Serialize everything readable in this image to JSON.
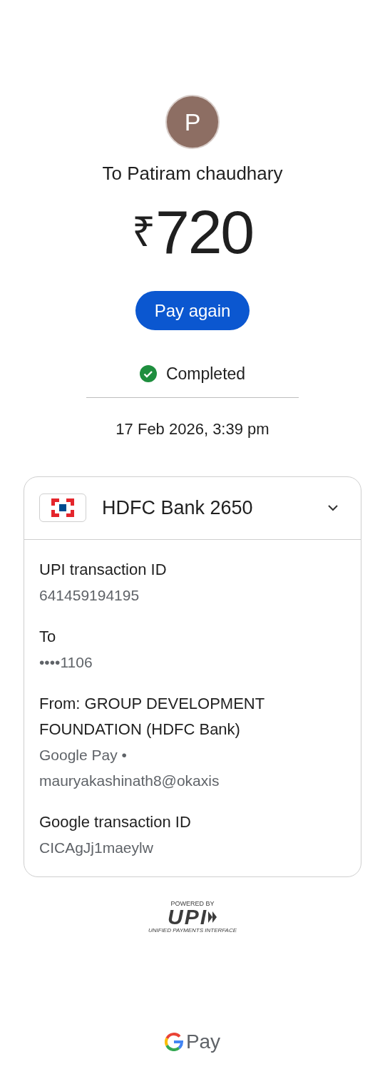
{
  "payee": {
    "initial": "P",
    "name": "To Patiram chaudhary"
  },
  "amount": {
    "currency": "₹",
    "value": "720"
  },
  "pay_again_button": "Pay again",
  "status": {
    "kind": "completed",
    "label": "Completed"
  },
  "datetime": "17 Feb 2026, 3:39 pm",
  "account": {
    "bank": "HDFC Bank 2650",
    "expanded": true
  },
  "details": [
    {
      "label": "UPI transaction ID",
      "lines": [
        "641459194195"
      ]
    },
    {
      "label": "To",
      "lines": [
        "••••1106"
      ]
    },
    {
      "label": "From: GROUP DEVELOPMENT FOUNDATION (HDFC Bank)",
      "lines": [
        "Google Pay •",
        "mauryakashinath8@okaxis"
      ]
    },
    {
      "label": "Google transaction ID",
      "lines": [
        "CICAgJj1maeylw"
      ]
    }
  ],
  "upi_badge": {
    "top": "POWERED BY",
    "mark": "UPI",
    "bottom": "UNIFIED PAYMENTS INTERFACE"
  },
  "footer_brand": "Pay"
}
